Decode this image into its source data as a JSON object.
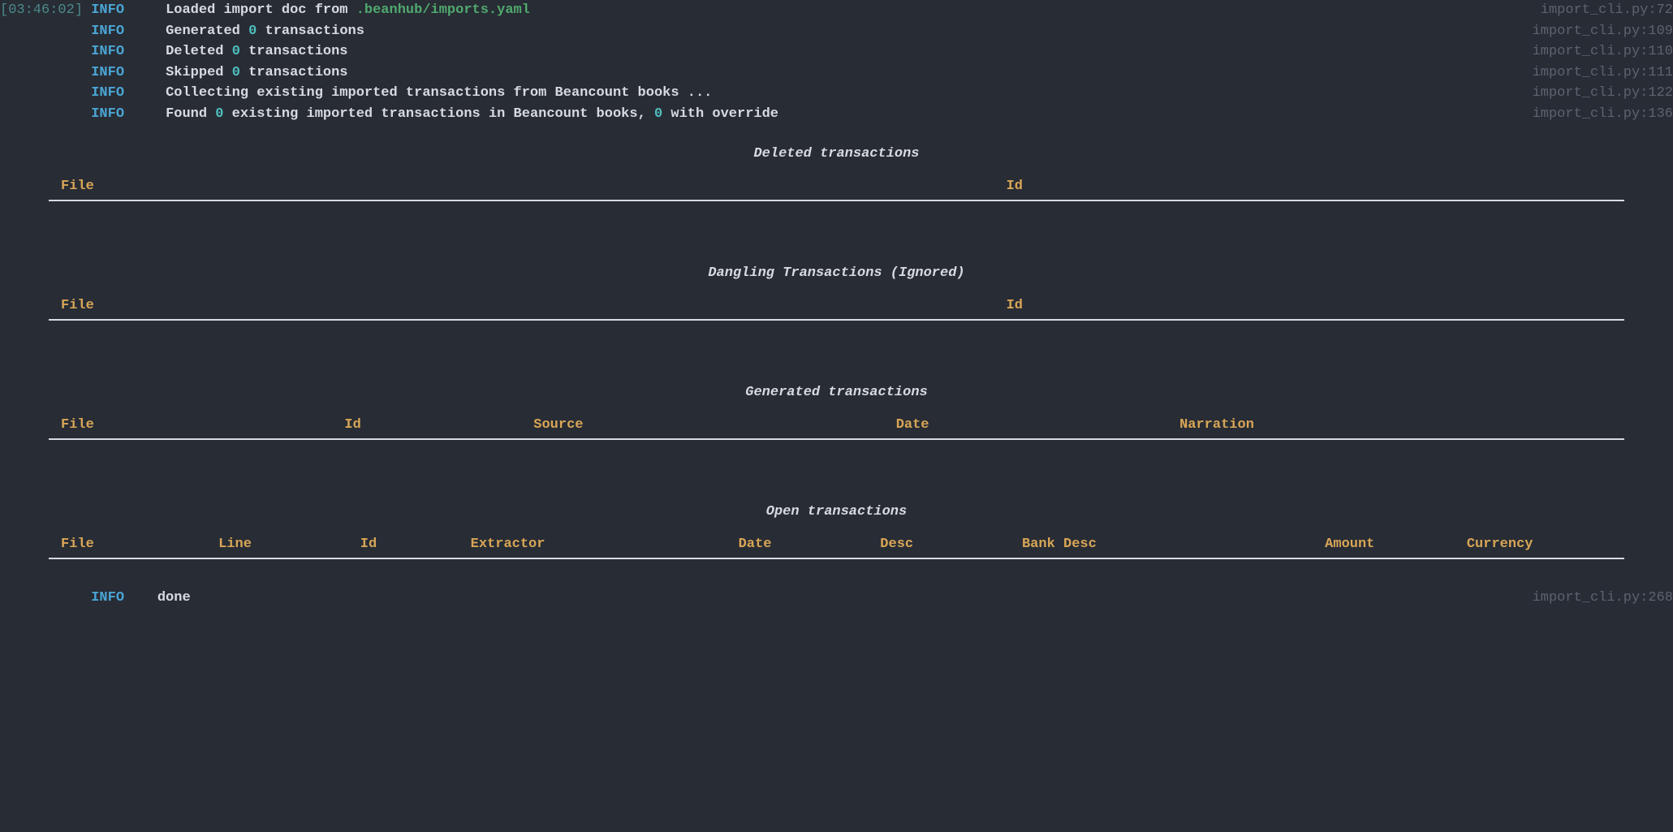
{
  "timestamp": "[03:46:02]",
  "log_lines": [
    {
      "level": "INFO",
      "msg_pre": "Loaded import doc from ",
      "msg_highlight": ".beanhub/imports.yaml",
      "msg_post": "",
      "source": "import_cli.py",
      "line": "72",
      "show_timestamp": true
    },
    {
      "level": "INFO",
      "msg_pre": "Generated ",
      "msg_num": "0",
      "msg_post": " transactions",
      "source": "import_cli.py",
      "line": "109",
      "show_timestamp": false
    },
    {
      "level": "INFO",
      "msg_pre": "Deleted ",
      "msg_num": "0",
      "msg_post": " transactions",
      "source": "import_cli.py",
      "line": "110",
      "show_timestamp": false
    },
    {
      "level": "INFO",
      "msg_pre": "Skipped ",
      "msg_num": "0",
      "msg_post": " transactions",
      "source": "import_cli.py",
      "line": "111",
      "show_timestamp": false
    },
    {
      "level": "INFO",
      "msg_full": "Collecting existing imported transactions from Beancount books ...",
      "source": "import_cli.py",
      "line": "122",
      "show_timestamp": false
    },
    {
      "level": "INFO",
      "msg_pre": "Found ",
      "msg_num": "0",
      "msg_mid": " existing imported transactions in Beancount books, ",
      "msg_num2": "0",
      "msg_post": " with override",
      "source": "import_cli.py",
      "line": "136",
      "show_timestamp": false
    }
  ],
  "sections": {
    "deleted": {
      "title": "Deleted transactions",
      "cols": [
        "File",
        "Id"
      ]
    },
    "dangling": {
      "title": "Dangling Transactions (Ignored)",
      "cols": [
        "File",
        "Id"
      ]
    },
    "generated": {
      "title": "Generated transactions",
      "cols": [
        "File",
        "Id",
        "Source",
        "Date",
        "Narration"
      ]
    },
    "open": {
      "title": "Open transactions",
      "cols": [
        "File",
        "Line",
        "Id",
        "Extractor",
        "Date",
        "Desc",
        "Bank Desc",
        "Amount",
        "Currency"
      ]
    }
  },
  "done_line": {
    "level": "INFO",
    "msg": "done",
    "source": "import_cli.py",
    "line": "268"
  }
}
